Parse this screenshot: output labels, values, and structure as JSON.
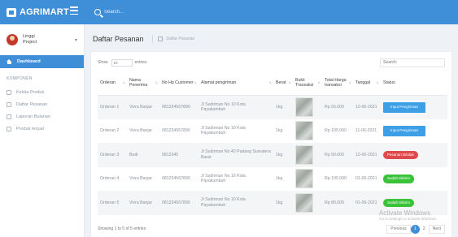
{
  "brand": {
    "name": "AGRIMART"
  },
  "topbar": {
    "search_placeholder": "Search..."
  },
  "sidebar": {
    "user": {
      "name_line1": "Linggi",
      "name_line2": "Project"
    },
    "dashboard_label": "Dashboard",
    "section_label": "KOMPONEN",
    "items": [
      {
        "label": "Kelola Produk",
        "icon": "box-icon"
      },
      {
        "label": "Daftar Pesanan",
        "icon": "list-icon"
      },
      {
        "label": "Laporan Bulanan",
        "icon": "report-icon"
      },
      {
        "label": "Produk terjual",
        "icon": "sold-icon"
      }
    ]
  },
  "page": {
    "title": "Daftar Pesanan",
    "breadcrumb": "Daftar Pesanan"
  },
  "table_controls": {
    "show_label": "Show",
    "show_value": "10",
    "entries_label": "entries",
    "search_placeholder": "Search:"
  },
  "table": {
    "headers": [
      "Orderan",
      "Nama Penerima",
      "No Hp Customer",
      "Alamat pengiriman",
      "Berat",
      "Bukti Transaksi",
      "Total Harga transaksi",
      "Tanggal",
      "Status"
    ],
    "rows": [
      {
        "orderan": "Orderan 1",
        "nama": "Vivra Banjar",
        "nohp": "081234567890",
        "alamat": "Jl Sudirman No 10 Kota Payakumbuh",
        "berat": "1kg",
        "total": "Rp 55.000",
        "tanggal": "12-06-2021",
        "status": "Input Pengiriman",
        "status_type": "blue"
      },
      {
        "orderan": "Orderan 2",
        "nama": "Vivra Banjar",
        "nohp": "081234567890",
        "alamat": "Jl Sudirman No 10 Kota Payakumbuh",
        "berat": "1kg",
        "total": "Rp 100.000",
        "tanggal": "11-06-2021",
        "status": "Input Pengiriman",
        "status_type": "blue"
      },
      {
        "orderan": "Orderan 3",
        "nama": "Budi",
        "nohp": "0812345",
        "alamat": "Jl Sudirman No 40 Padang Sumatera Barat",
        "berat": "1kg",
        "total": "Rp 50.000",
        "tanggal": "12-06-2021",
        "status": "Pesanan Ditolak",
        "status_type": "red"
      },
      {
        "orderan": "Orderan 4",
        "nama": "Vivra Banjar",
        "nohp": "081234567890",
        "alamat": "Jl Sudirman No 10 Kota Payakumbuh",
        "berat": "1kg",
        "total": "Rp 100.000",
        "tanggal": "01-06-2021",
        "status": "Sudah Dikirim",
        "status_type": "green"
      },
      {
        "orderan": "Orderan 5",
        "nama": "Vivra Banjar",
        "nohp": "081234567890",
        "alamat": "Jl Sudirman No 10 Kota Payakumbuh",
        "berat": "1kg",
        "total": "Rp 80.000",
        "tanggal": "01-06-2021",
        "status": "Sudah Dikirim",
        "status_type": "green"
      }
    ]
  },
  "footer": {
    "info": "Showing 1 to 5 of 5 entries",
    "previous": "Previous",
    "pages": [
      "1",
      "2"
    ],
    "next": "Next"
  },
  "watermark": {
    "title": "Activate Windows",
    "subtitle": "Go to Settings to activate Windows."
  },
  "colors": {
    "primary": "#3f8fd8",
    "status_blue": "#3d9fe6",
    "status_red": "#e04949",
    "status_green": "#3bc23b"
  }
}
